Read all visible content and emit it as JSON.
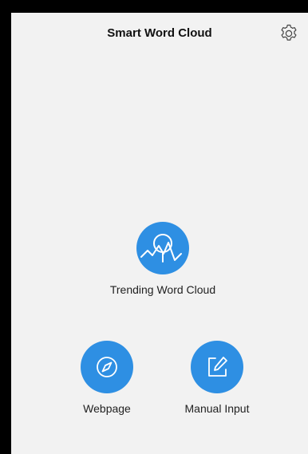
{
  "header": {
    "title": "Smart Word Cloud",
    "settings_icon": "gear-icon"
  },
  "actions": {
    "trending": {
      "label": "Trending Word Cloud",
      "icon": "trending-search-icon"
    },
    "webpage": {
      "label": "Webpage",
      "icon": "compass-icon"
    },
    "manual": {
      "label": "Manual Input",
      "icon": "edit-icon"
    }
  },
  "colors": {
    "accent": "#2e8fe3",
    "background": "#f2f2f2",
    "frame": "#000000"
  }
}
